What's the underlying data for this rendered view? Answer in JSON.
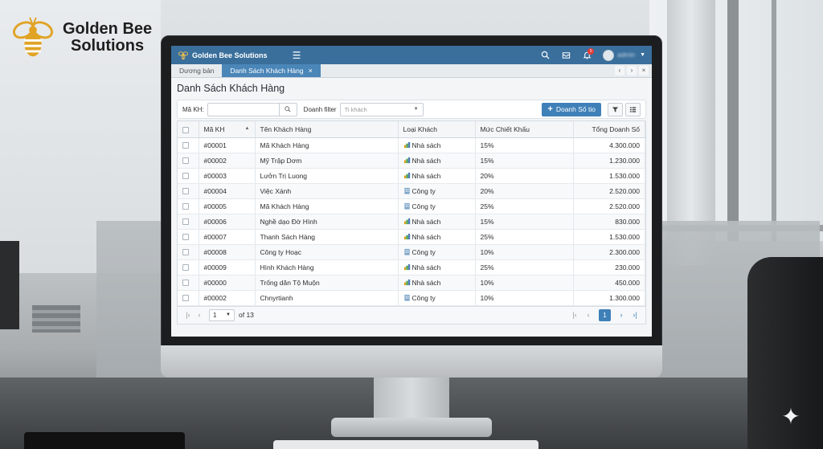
{
  "brand": {
    "line1": "Golden Bee",
    "line2": "Solutions"
  },
  "app": {
    "title": "Golden Bee Solutions",
    "notification_count": "5",
    "user_name": "admin"
  },
  "tabs": [
    {
      "label": "Dương bản"
    },
    {
      "label": "Danh Sách Khách Hàng"
    }
  ],
  "page": {
    "title": "Danh Sách Khách Hàng"
  },
  "filters": {
    "code_label": "Mã KH:",
    "code_placeholder": "",
    "revenue_label": "Doanh filter",
    "revenue_placeholder": "Ti khách",
    "add_button": "Doanh Số tio"
  },
  "table": {
    "headers": [
      "Mã KH",
      "Tên Khách Hàng",
      "Loại Khách",
      "Mức Chiết Khấu",
      "Tổng Doanh Số"
    ],
    "rows": [
      {
        "code": "#00001",
        "name": "Mã Khách Hàng",
        "type": "Nhà sách",
        "discount": "15%",
        "total": "4.300.000"
      },
      {
        "code": "#00002",
        "name": "Mỹ Trập Dơm",
        "type": "Nhà sách",
        "discount": "15%",
        "total": "1.230.000"
      },
      {
        "code": "#00003",
        "name": "Lưởn Trị Luong",
        "type": "Nhà sách",
        "discount": "20%",
        "total": "1.530.000"
      },
      {
        "code": "#00004",
        "name": "Việc Xánh",
        "type": "Công ty",
        "discount": "20%",
        "total": "2.520.000"
      },
      {
        "code": "#00005",
        "name": "Mã Khách Hàng",
        "type": "Công ty",
        "discount": "25%",
        "total": "2.520.000"
      },
      {
        "code": "#00006",
        "name": "Nghề dạo Đờ Hình",
        "type": "Nhà sách",
        "discount": "15%",
        "total": "830.000"
      },
      {
        "code": "#00007",
        "name": "Thanh Sách Hàng",
        "type": "Nhà sách",
        "discount": "25%",
        "total": "1.530.000"
      },
      {
        "code": "#00008",
        "name": "Công ty Hoạc",
        "type": "Công ty",
        "discount": "10%",
        "total": "2.300.000"
      },
      {
        "code": "#00009",
        "name": "Hình Khách Hàng",
        "type": "Nhà sách",
        "discount": "25%",
        "total": "230.000"
      },
      {
        "code": "#00000",
        "name": "Trống dăn Tộ Muộn",
        "type": "Nhà sách",
        "discount": "10%",
        "total": "450.000"
      },
      {
        "code": "#00002",
        "name": "Chnyrtianh",
        "type": "Công ty",
        "discount": "10%",
        "total": "1.300.000"
      }
    ]
  },
  "pager": {
    "page_select": "1",
    "of_total": "of 13",
    "current": "1"
  },
  "colors": {
    "header_bg": "#3a6f9c",
    "active_tab": "#4a86b8",
    "primary_button": "#3f80b8"
  },
  "icons": {
    "bookstore": "bookstore-icon",
    "company": "building-icon"
  }
}
